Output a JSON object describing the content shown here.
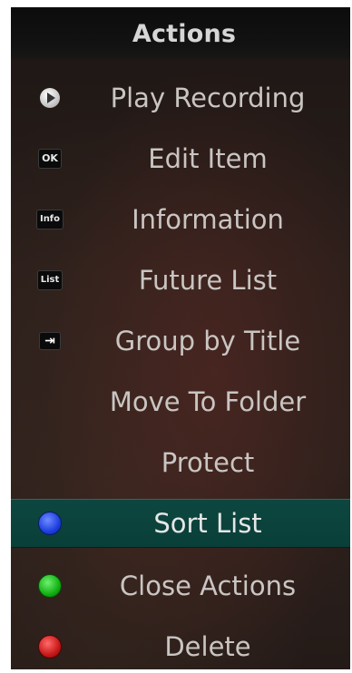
{
  "menu": {
    "title": "Actions",
    "items": [
      {
        "label": "Play Recording",
        "icon": "play-icon",
        "icon_text": ""
      },
      {
        "label": "Edit Item",
        "icon": "ok-key-icon",
        "icon_text": "OK"
      },
      {
        "label": "Information",
        "icon": "info-key-icon",
        "icon_text": "Info"
      },
      {
        "label": "Future List",
        "icon": "list-key-icon",
        "icon_text": "List"
      },
      {
        "label": "Group by Title",
        "icon": "group-arrow-icon",
        "icon_text": "⇥"
      },
      {
        "label": "Move To Folder",
        "icon": "",
        "icon_text": ""
      },
      {
        "label": "Protect",
        "icon": "",
        "icon_text": ""
      },
      {
        "label": "Sort List",
        "icon": "blue-button-icon",
        "icon_text": "",
        "selected": true
      },
      {
        "label": "Close Actions",
        "icon": "green-button-icon",
        "icon_text": ""
      },
      {
        "label": "Delete",
        "icon": "red-button-icon",
        "icon_text": ""
      }
    ]
  },
  "colors": {
    "selected_background": "#0a3f39",
    "header_background": "#121212",
    "text": "#c9c5c2",
    "blue_button": "#1d3fe0",
    "green_button": "#13b013",
    "red_button": "#c81818"
  }
}
